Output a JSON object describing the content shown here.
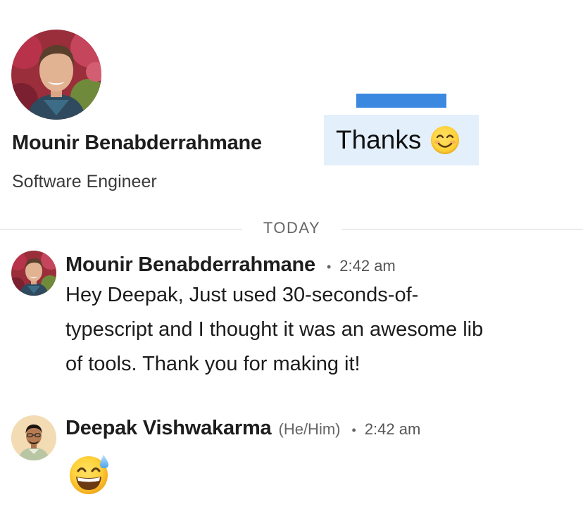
{
  "profile": {
    "name": "Mounir Benabderrahmane",
    "headline": "Software Engineer"
  },
  "annotation": {
    "thanks_text": "Thanks",
    "emoji": "smiling-face-icon",
    "highlight_color": "#3b88e0",
    "box_color": "#e3f0fc"
  },
  "divider": {
    "label": "TODAY"
  },
  "messages": [
    {
      "sender": "Mounir Benabderrahmane",
      "pronouns": "",
      "time": "2:42 am",
      "avatar": "avatar-photo",
      "body_lines": [
        "Hey Deepak, Just used 30-seconds-of-",
        "typescript and I thought it was an awesome lib",
        "of tools. Thank you for making it!"
      ]
    },
    {
      "sender": "Deepak Vishwakarma",
      "pronouns": "(He/Him)",
      "time": "2:42 am",
      "avatar": "avatar-photo",
      "emoji": "grinning-sweat-icon"
    }
  ],
  "separator": "•"
}
